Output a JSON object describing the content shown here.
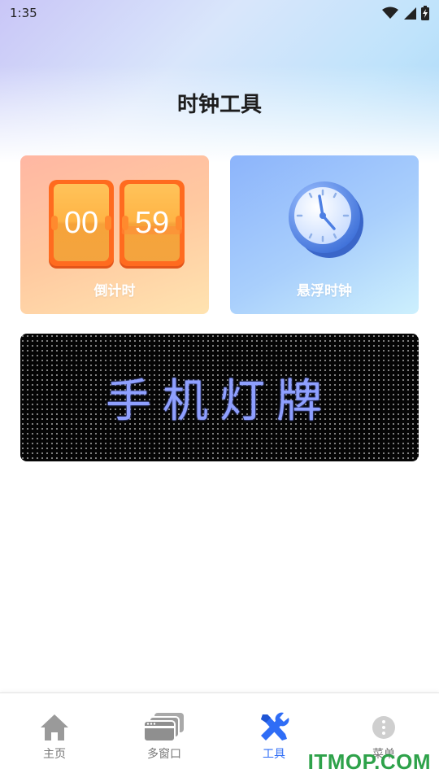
{
  "status_bar": {
    "time": "1:35",
    "icons": [
      "wifi-icon",
      "signal-icon",
      "battery-charging-icon"
    ]
  },
  "page": {
    "title": "时钟工具"
  },
  "cards": {
    "countdown": {
      "label": "倒计时",
      "digits_left": "00",
      "digits_right": "59",
      "icon": "flip-clock-icon"
    },
    "floating_clock": {
      "label": "悬浮时钟",
      "icon": "alarm-clock-icon"
    }
  },
  "banner": {
    "text": "手机灯牌"
  },
  "bottom_nav": {
    "items": [
      {
        "label": "主页",
        "icon": "home-icon",
        "active": false
      },
      {
        "label": "多窗口",
        "icon": "multi-window-icon",
        "active": false
      },
      {
        "label": "工具",
        "icon": "tools-icon",
        "active": true
      },
      {
        "label": "菜单",
        "icon": "more-icon",
        "active": false
      }
    ]
  },
  "colors": {
    "accent": "#2f6df6",
    "inactive": "#777777",
    "banner_text": "#8fa0ff"
  },
  "watermark": "ITMOP.COM"
}
